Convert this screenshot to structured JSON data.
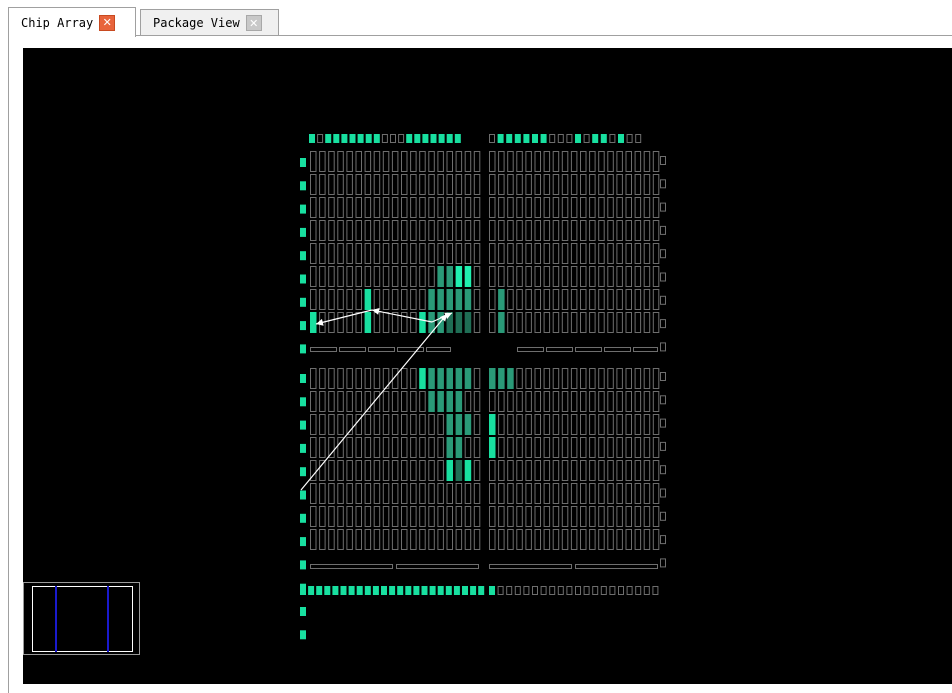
{
  "tabs": [
    {
      "label": "Chip Array",
      "active": true,
      "close_icon": "close-icon"
    },
    {
      "label": "Package View",
      "active": false,
      "close_icon": "close-icon"
    }
  ],
  "colors": {
    "background": "#000000",
    "cell_outline": "#6e6e6e",
    "io_active": "#18e0a0",
    "io_bright": "#20f0b0",
    "cell_dim": "#1f6e55",
    "cell_mid": "#2a9a78",
    "route": "#ffffff",
    "minimap_divider": "#1a1acc"
  },
  "chip": {
    "top_io_used": [
      1,
      0,
      1,
      1,
      1,
      1,
      1,
      1,
      1,
      0,
      0,
      0,
      1,
      1,
      1,
      1,
      1,
      1,
      1,
      0,
      1,
      1,
      1,
      1,
      1,
      1,
      0,
      0,
      0,
      1,
      0,
      1,
      1,
      0,
      1,
      0,
      0
    ],
    "bottom_io_used": [
      1,
      1,
      1,
      1,
      1,
      1,
      1,
      1,
      1,
      1,
      1,
      1,
      1,
      1,
      1,
      1,
      1,
      1,
      1,
      1,
      1,
      1,
      1,
      1,
      0,
      0,
      0,
      0,
      0,
      0,
      0,
      0,
      0,
      0,
      0,
      0,
      0
    ],
    "left_io_upper_used": [
      1,
      1,
      1,
      1,
      1,
      1,
      1,
      1,
      1
    ],
    "left_io_lower_used": [
      1,
      1,
      1,
      1,
      1,
      1,
      1,
      1,
      1,
      1,
      1,
      1
    ]
  }
}
